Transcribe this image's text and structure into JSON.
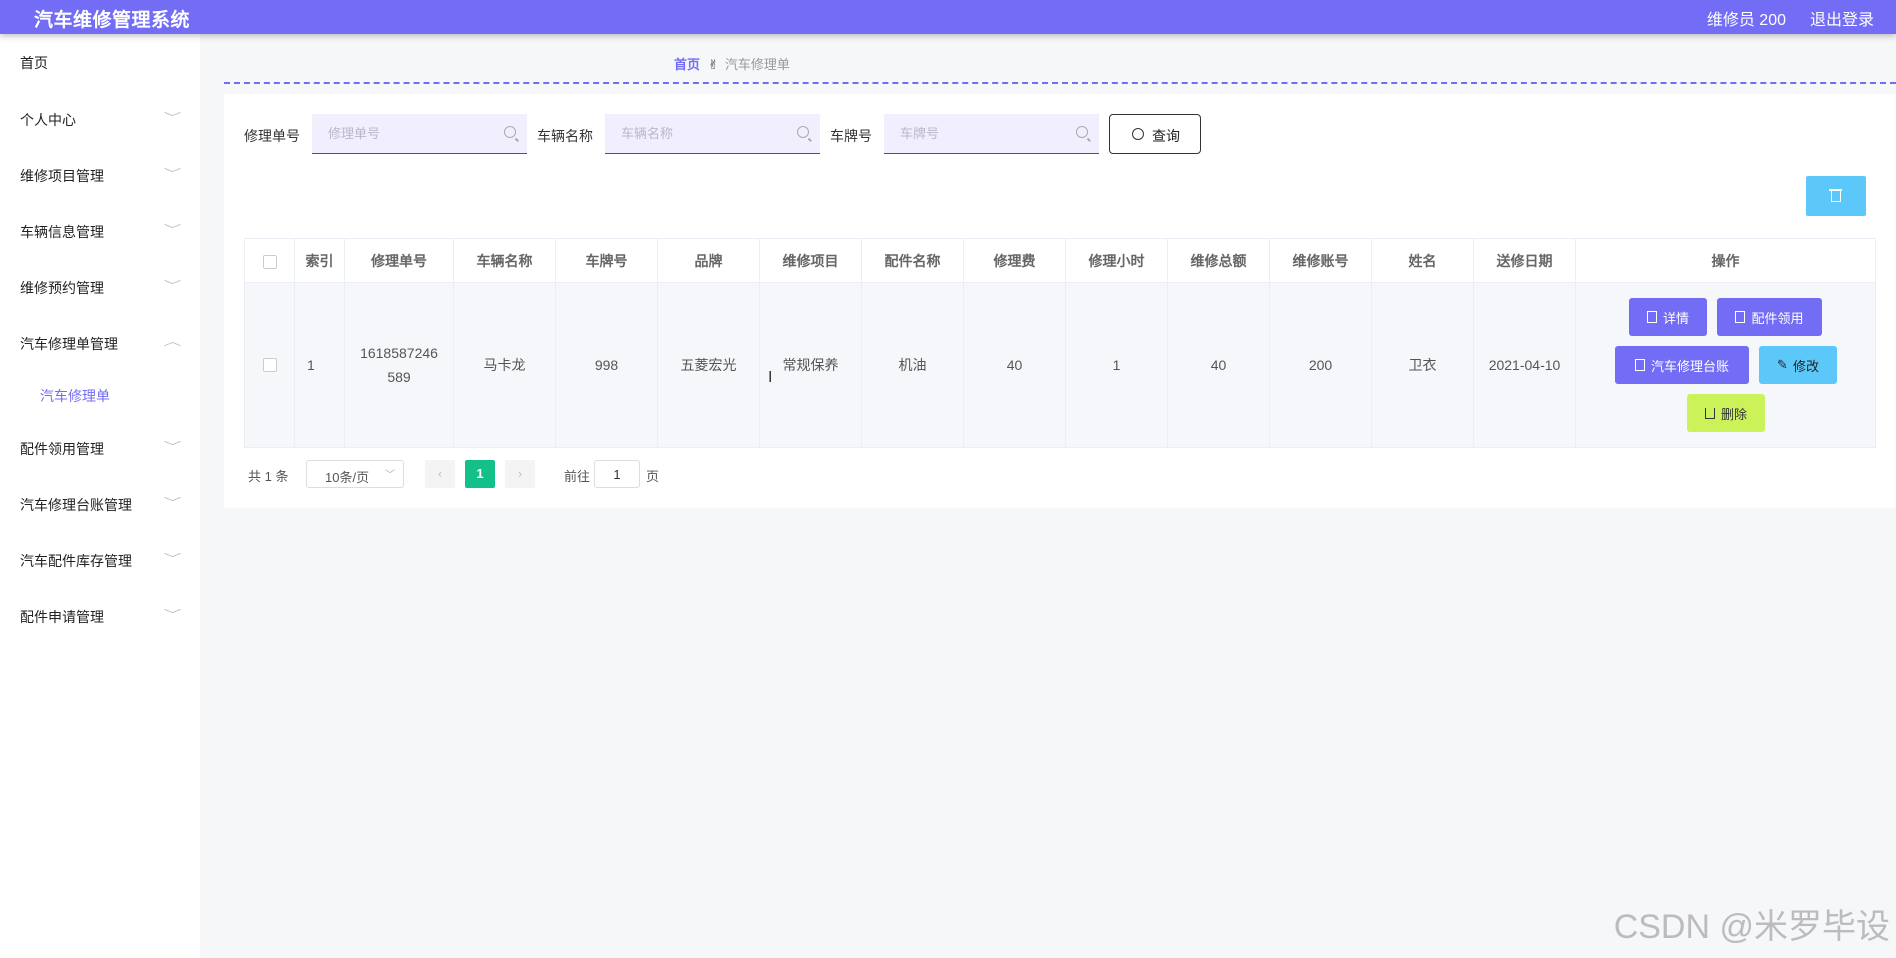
{
  "header": {
    "title": "汽车维修管理系统",
    "user": "维修员 200",
    "logout": "退出登录"
  },
  "sidebar": {
    "items": [
      {
        "label": "首页",
        "chevron": ""
      },
      {
        "label": "个人中心",
        "chevron": "﹀"
      },
      {
        "label": "维修项目管理",
        "chevron": "﹀"
      },
      {
        "label": "车辆信息管理",
        "chevron": "﹀"
      },
      {
        "label": "维修预约管理",
        "chevron": "﹀"
      },
      {
        "label": "汽车修理单管理",
        "chevron": "︿"
      },
      {
        "label": "配件领用管理",
        "chevron": "﹀"
      },
      {
        "label": "汽车修理台账管理",
        "chevron": "﹀"
      },
      {
        "label": "汽车配件库存管理",
        "chevron": "﹀"
      },
      {
        "label": "配件申请管理",
        "chevron": "﹀"
      }
    ],
    "sub_item": "汽车修理单"
  },
  "breadcrumb": {
    "home": "首页",
    "current": "汽车修理单"
  },
  "search": {
    "f1_label": "修理单号",
    "f1_placeholder": "修理单号",
    "f2_label": "车辆名称",
    "f2_placeholder": "车辆名称",
    "f3_label": "车牌号",
    "f3_placeholder": "车牌号",
    "query": "查询"
  },
  "table": {
    "headers": [
      "索引",
      "修理单号",
      "车辆名称",
      "车牌号",
      "品牌",
      "维修项目",
      "配件名称",
      "修理费",
      "修理小时",
      "维修总额",
      "维修账号",
      "姓名",
      "送修日期",
      "操作"
    ],
    "rows": [
      {
        "index": "1",
        "order_no": "1618587246\n589",
        "car_name": "马卡龙",
        "plate": "998",
        "brand": "五菱宏光",
        "item": "常规保养",
        "part": "机油",
        "fee": "40",
        "hours": "1",
        "total": "40",
        "account": "200",
        "name": "卫衣",
        "date": "2021-04-10"
      }
    ],
    "actions": {
      "detail": "详情",
      "parts": "配件领用",
      "ledger": "汽车修理台账",
      "edit": "修改",
      "delete": "删除"
    }
  },
  "pagination": {
    "total": "共 1 条",
    "page_size": "10条/页",
    "current": "1",
    "goto": "前往",
    "goto_value": "1",
    "page_unit": "页"
  },
  "watermark": "CSDN @米罗毕设",
  "colors": {
    "brand": "#736df6",
    "info": "#5cc8f9",
    "success": "#ccf25a",
    "pager": "#13c08a"
  }
}
